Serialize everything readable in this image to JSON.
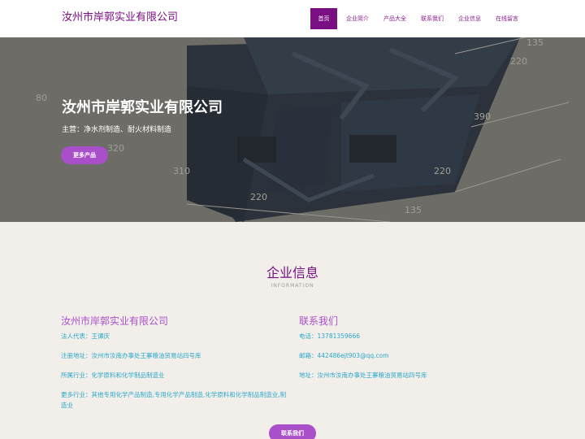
{
  "header": {
    "logo": "汝州市岸郭实业有限公司",
    "nav": [
      "首页",
      "企业简介",
      "产品大全",
      "联系我们",
      "企业信息",
      "在线留言"
    ]
  },
  "hero": {
    "title": "汝州市岸郭实业有限公司",
    "subtitle": "主营：净水剂制造、耐火材料制造",
    "button": "更多产品",
    "dimension_labels": [
      "135",
      "220",
      "390",
      "220",
      "135",
      "310",
      "220",
      "320",
      "80"
    ]
  },
  "info": {
    "title": "企业信息",
    "subtitle": "INFORMATION",
    "company": {
      "name": "汝州市岸郭实业有限公司",
      "legal_rep": "法人代表：王谭庆",
      "address": "注册地址：汝州市汝南办事处王寨粮油贸易站四号库",
      "industry": "所属行业：化学原料和化学制品制造业",
      "more_industry": "更多行业：其他专用化学产品制造,专用化学产品制造,化学原料和化学制品制造业,制造业"
    },
    "contact": {
      "title": "联系我们",
      "phone": "电话：13781359666",
      "email": "邮箱：442486ejt903@qq.com",
      "address": "地址：汝州市汝南办事处王寨粮油贸易站四号库"
    },
    "button": "联系我们"
  },
  "colors": {
    "brand": "#7a0f84",
    "accent": "#a94fc9",
    "text_info": "#2aa7c9"
  }
}
